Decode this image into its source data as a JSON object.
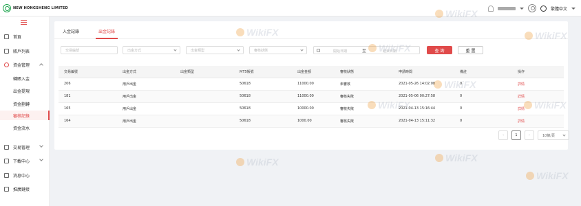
{
  "header": {
    "brand": "NEW HONGSHENG LIMITED",
    "language": "繁體中文"
  },
  "sidebar": {
    "items": [
      {
        "label": "首頁"
      },
      {
        "label": "賬戶列表"
      },
      {
        "label": "資金管理"
      },
      {
        "label": "轉賬入金"
      },
      {
        "label": "出金提現"
      },
      {
        "label": "資金劃轉"
      },
      {
        "label": "審核記錄"
      },
      {
        "label": "資金流水"
      },
      {
        "label": "交易管理"
      },
      {
        "label": "下載中心"
      },
      {
        "label": "消息中心"
      },
      {
        "label": "推廣鏈接"
      }
    ]
  },
  "tabs": [
    {
      "label": "入金記錄"
    },
    {
      "label": "出金記錄"
    }
  ],
  "filters": {
    "trade_no_placeholder": "交易編號",
    "method_placeholder": "出金方式",
    "type_placeholder": "出金類型",
    "status_placeholder": "審核狀態",
    "start_placeholder": "開始日期",
    "date_sep": "至",
    "end_placeholder": "結束日期",
    "query_label": "查 詢",
    "reset_label": "重 置"
  },
  "table": {
    "headers": [
      "交易編號",
      "出金方式",
      "出金類型",
      "MT5帳號",
      "出金金額",
      "審核狀態",
      "申請時間",
      "備註",
      "操作"
    ],
    "rows": [
      [
        "206",
        "用戶出金",
        "",
        "50618",
        "11000.00",
        "未審核",
        "2021-05-26 14:02:08",
        "0",
        "詳情"
      ],
      [
        "181",
        "用戶出金",
        "",
        "50618",
        "11000.00",
        "審核失敗",
        "2021-05-06 00:27:58",
        "0",
        "詳情"
      ],
      [
        "165",
        "用戶出金",
        "",
        "50618",
        "10000.00",
        "審核失敗",
        "2021-04-13 15:16:44",
        "0",
        "詳情"
      ],
      [
        "164",
        "用戶出金",
        "",
        "50618",
        "1000.00",
        "審核失敗",
        "2021-04-13 15:11:32",
        "0",
        "詳情"
      ]
    ]
  },
  "pagination": {
    "prev": "‹",
    "page": "1",
    "next": "›",
    "page_size": "10條/頁"
  },
  "watermark": "WikiFX",
  "colors": {
    "accent": "#e04a4a",
    "brand_green": "#1aa34a"
  }
}
